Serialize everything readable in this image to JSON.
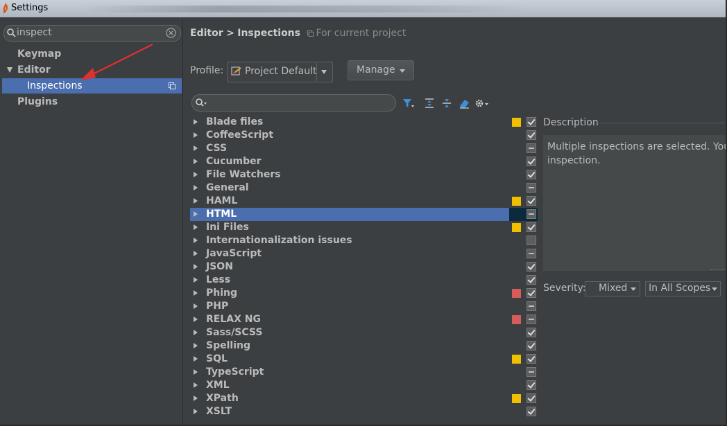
{
  "window": {
    "title": "Settings"
  },
  "sidebar": {
    "search_value": "inspect",
    "items": [
      {
        "label": "Keymap"
      },
      {
        "label": "Editor",
        "expanded": true
      },
      {
        "label": "Inspections",
        "selected": true
      },
      {
        "label": "Plugins"
      }
    ]
  },
  "header": {
    "breadcrumb_parent": "Editor",
    "breadcrumb_separator": ">",
    "breadcrumb_current": "Inspections",
    "scope_note": "For current project"
  },
  "profile": {
    "label": "Profile:",
    "value": "Project Default",
    "manage_label": "Manage"
  },
  "filter": {
    "placeholder": ""
  },
  "inspections": [
    {
      "label": "Blade files",
      "severity_color": "#f0c000",
      "state": "checked"
    },
    {
      "label": "CoffeeScript",
      "severity_color": null,
      "state": "checked"
    },
    {
      "label": "CSS",
      "severity_color": null,
      "state": "mixed"
    },
    {
      "label": "Cucumber",
      "severity_color": null,
      "state": "checked"
    },
    {
      "label": "File Watchers",
      "severity_color": null,
      "state": "checked"
    },
    {
      "label": "General",
      "severity_color": null,
      "state": "mixed"
    },
    {
      "label": "HAML",
      "severity_color": "#f0c000",
      "state": "checked"
    },
    {
      "label": "HTML",
      "severity_color": null,
      "state": "mixed",
      "selected": true
    },
    {
      "label": "Ini Files",
      "severity_color": "#f0c000",
      "state": "checked"
    },
    {
      "label": "Internationalization issues",
      "severity_color": null,
      "state": "unchecked"
    },
    {
      "label": "JavaScript",
      "severity_color": null,
      "state": "mixed"
    },
    {
      "label": "JSON",
      "severity_color": null,
      "state": "checked"
    },
    {
      "label": "Less",
      "severity_color": null,
      "state": "checked"
    },
    {
      "label": "Phing",
      "severity_color": "#d65c5c",
      "state": "checked"
    },
    {
      "label": "PHP",
      "severity_color": null,
      "state": "mixed"
    },
    {
      "label": "RELAX NG",
      "severity_color": "#d65c5c",
      "state": "mixed"
    },
    {
      "label": "Sass/SCSS",
      "severity_color": null,
      "state": "checked"
    },
    {
      "label": "Spelling",
      "severity_color": null,
      "state": "checked"
    },
    {
      "label": "SQL",
      "severity_color": "#f0c000",
      "state": "checked"
    },
    {
      "label": "TypeScript",
      "severity_color": null,
      "state": "mixed"
    },
    {
      "label": "XML",
      "severity_color": null,
      "state": "checked"
    },
    {
      "label": "XPath",
      "severity_color": "#f0c000",
      "state": "checked"
    },
    {
      "label": "XSLT",
      "severity_color": null,
      "state": "checked"
    }
  ],
  "description": {
    "label": "Description",
    "line1": "Multiple inspections are selected. You",
    "line2": "inspection."
  },
  "severity": {
    "label": "Severity:",
    "value": "Mixed",
    "scope_value": "In All Scopes"
  },
  "colors": {
    "accent_selection": "#4b6eaf",
    "background": "#3c3f41",
    "warning": "#f0c000",
    "error": "#d65c5c"
  },
  "icons": {
    "toolbar": [
      "filter-icon",
      "expand-all-icon",
      "collapse-all-icon",
      "reset-icon",
      "settings-icon"
    ]
  }
}
